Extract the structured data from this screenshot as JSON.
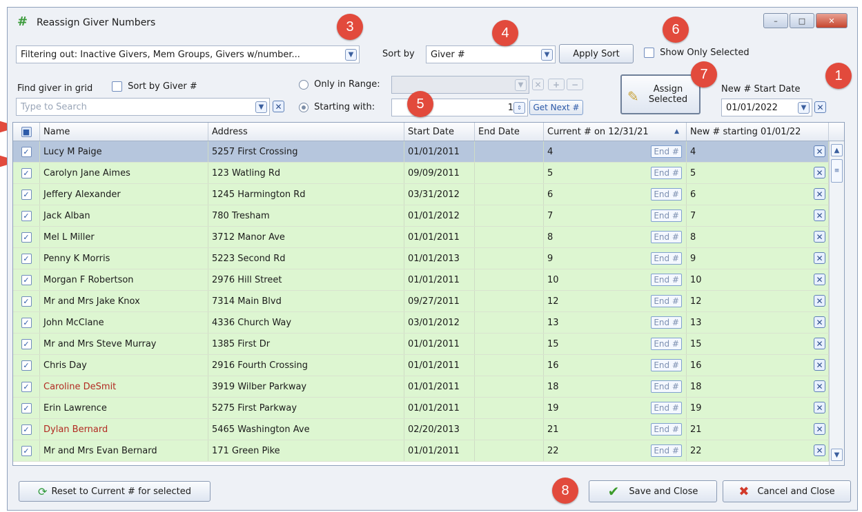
{
  "window": {
    "title": "Reassign Giver Numbers",
    "min": "–",
    "max": "□",
    "close": "✕"
  },
  "filter": {
    "value": "Filtering out: Inactive Givers, Mem Groups, Givers w/number..."
  },
  "sort": {
    "label": "Sort by",
    "value": "Giver #",
    "apply": "Apply Sort"
  },
  "show_only_selected": {
    "label": "Show Only Selected",
    "checked": false
  },
  "find": {
    "label": "Find giver in grid",
    "sort_label": "Sort by Giver #",
    "placeholder": "Type to Search"
  },
  "range": {
    "only_label": "Only in Range:",
    "starting_label": "Starting with:",
    "starting_value": "1",
    "get_next": "Get Next #"
  },
  "assign": {
    "line1": "Assign",
    "line2": "Selected"
  },
  "start_date": {
    "label": "New # Start Date",
    "value": "01/01/2022"
  },
  "badges": [
    "1",
    "3",
    "4",
    "5",
    "6",
    "7",
    "8"
  ],
  "grid": {
    "columns": [
      "Name",
      "Address",
      "Start Date",
      "End Date",
      "Current # on 12/31/21",
      "New # starting 01/01/22"
    ],
    "end_label": "End #",
    "rows": [
      {
        "name": "Lucy M Paige",
        "address": "5257 First Crossing",
        "start": "01/01/2011",
        "end": "",
        "current": "4",
        "new": "4",
        "highlight": true,
        "red": false
      },
      {
        "name": "Carolyn Jane Aimes",
        "address": "123 Watling Rd",
        "start": "09/09/2011",
        "end": "",
        "current": "5",
        "new": "5",
        "highlight": false,
        "red": false
      },
      {
        "name": "Jeffery Alexander",
        "address": "1245 Harmington Rd",
        "start": "03/31/2012",
        "end": "",
        "current": "6",
        "new": "6",
        "highlight": false,
        "red": false
      },
      {
        "name": "Jack Alban",
        "address": "780 Tresham",
        "start": "01/01/2012",
        "end": "",
        "current": "7",
        "new": "7",
        "highlight": false,
        "red": false
      },
      {
        "name": "Mel L Miller",
        "address": "3712 Manor Ave",
        "start": "01/01/2011",
        "end": "",
        "current": "8",
        "new": "8",
        "highlight": false,
        "red": false
      },
      {
        "name": "Penny K Morris",
        "address": "5223 Second Rd",
        "start": "01/01/2013",
        "end": "",
        "current": "9",
        "new": "9",
        "highlight": false,
        "red": false
      },
      {
        "name": "Morgan F Robertson",
        "address": "2976 Hill Street",
        "start": "01/01/2011",
        "end": "",
        "current": "10",
        "new": "10",
        "highlight": false,
        "red": false
      },
      {
        "name": "Mr and Mrs Jake Knox",
        "address": "7314 Main Blvd",
        "start": "09/27/2011",
        "end": "",
        "current": "12",
        "new": "12",
        "highlight": false,
        "red": false
      },
      {
        "name": "John McClane",
        "address": "4336 Church Way",
        "start": "03/01/2012",
        "end": "",
        "current": "13",
        "new": "13",
        "highlight": false,
        "red": false
      },
      {
        "name": "Mr and Mrs Steve Murray",
        "address": "1385 First Dr",
        "start": "01/01/2011",
        "end": "",
        "current": "15",
        "new": "15",
        "highlight": false,
        "red": false
      },
      {
        "name": "Chris Day",
        "address": "2916 Fourth Crossing",
        "start": "01/01/2011",
        "end": "",
        "current": "16",
        "new": "16",
        "highlight": false,
        "red": false
      },
      {
        "name": "Caroline DeSmit",
        "address": "3919 Wilber Parkway",
        "start": "01/01/2011",
        "end": "",
        "current": "18",
        "new": "18",
        "highlight": false,
        "red": true
      },
      {
        "name": "Erin Lawrence",
        "address": "5275 First Parkway",
        "start": "01/01/2011",
        "end": "",
        "current": "19",
        "new": "19",
        "highlight": false,
        "red": false
      },
      {
        "name": "Dylan Bernard",
        "address": "5465 Washington Ave",
        "start": "02/20/2013",
        "end": "",
        "current": "21",
        "new": "21",
        "highlight": false,
        "red": true
      },
      {
        "name": "Mr and Mrs Evan Bernard",
        "address": "171 Green Pike",
        "start": "01/01/2011",
        "end": "",
        "current": "22",
        "new": "22",
        "highlight": false,
        "red": false
      }
    ]
  },
  "footer": {
    "reset": "Reset to Current # for selected",
    "save": "Save and Close",
    "cancel": "Cancel and Close"
  },
  "colors": {
    "row_green": "#ddf6d1",
    "row_selected": "#b6c6dd",
    "red_text": "#b22a22",
    "badge": "#e24a3c"
  }
}
